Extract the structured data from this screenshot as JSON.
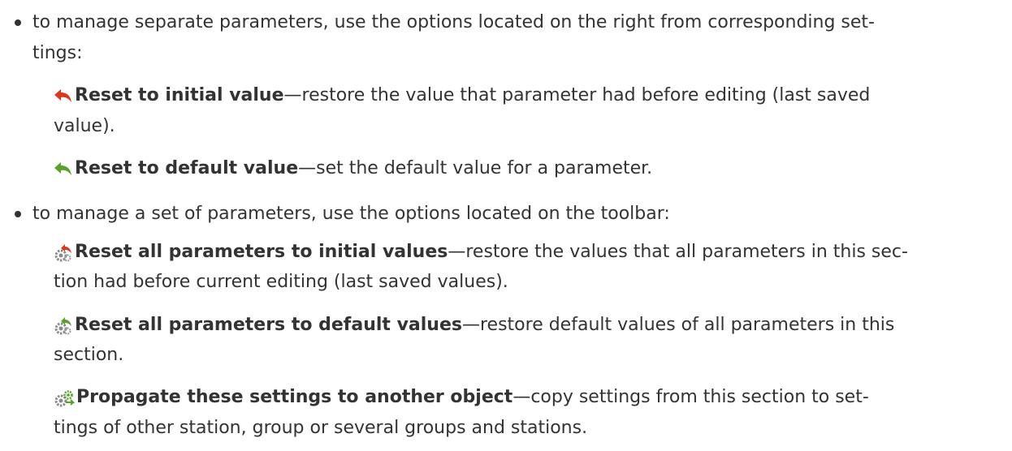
{
  "bullets": [
    {
      "text_line1": "to manage separate parameters, use the options located on the right from corresponding set-",
      "text_line2": "tings:",
      "items": [
        {
          "icon": "undo-arrow-red-icon",
          "title": "Reset to initial value",
          "desc_line1": "—restore the value that parameter had before editing (last saved",
          "desc_line2": "value)."
        },
        {
          "icon": "undo-arrow-green-icon",
          "title": "Reset to default value",
          "desc_line1": "—set the default value for a parameter."
        }
      ]
    },
    {
      "text_line1": "to manage a set of parameters, use the options located on the toolbar:",
      "items": [
        {
          "icon": "gears-undo-red-icon",
          "title": "Reset all parameters to initial values",
          "desc_line1": "—restore the values that all parameters in this sec-",
          "desc_line2": "tion had before current editing (last saved values)."
        },
        {
          "icon": "gears-undo-green-icon",
          "title": "Reset all parameters to default values",
          "desc_line1": "—restore default values of all parameters in this",
          "desc_line2": "section."
        },
        {
          "icon": "gears-propagate-icon",
          "title": "Propagate these settings to another object",
          "desc_line1": "—copy settings from this section to set-",
          "desc_line2": "tings of other station, group or several groups and stations."
        }
      ]
    }
  ],
  "colors": {
    "text": "#333333",
    "arrow_red": "#d93a1f",
    "arrow_green": "#5aa02c",
    "gear": "#8a8a8a"
  }
}
